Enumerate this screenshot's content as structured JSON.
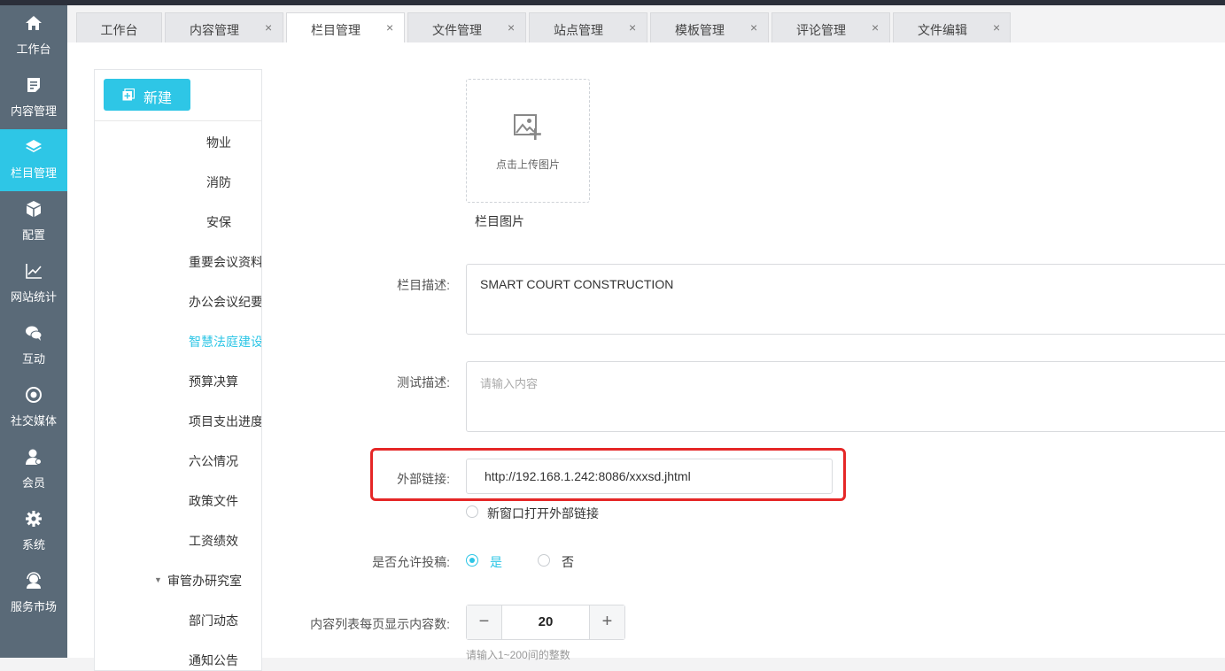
{
  "sidebar": {
    "items": [
      {
        "label": "工作台",
        "icon": "home-icon"
      },
      {
        "label": "内容管理",
        "icon": "document-icon"
      },
      {
        "label": "栏目管理",
        "icon": "layers-icon"
      },
      {
        "label": "配置",
        "icon": "cube-icon"
      },
      {
        "label": "网站统计",
        "icon": "line-chart-icon"
      },
      {
        "label": "互动",
        "icon": "chat-icon"
      },
      {
        "label": "社交媒体",
        "icon": "target-icon"
      },
      {
        "label": "会员",
        "icon": "member-icon"
      },
      {
        "label": "系统",
        "icon": "gear-icon"
      },
      {
        "label": "服务市场",
        "icon": "headset-icon"
      }
    ],
    "active_index": 2,
    "accent_color": "#2ec6e6"
  },
  "tabs": [
    {
      "label": "工作台"
    },
    {
      "label": "内容管理",
      "close": "×"
    },
    {
      "label": "栏目管理",
      "close": "×"
    },
    {
      "label": "文件管理",
      "close": "×"
    },
    {
      "label": "站点管理",
      "close": "×"
    },
    {
      "label": "模板管理",
      "close": "×"
    },
    {
      "label": "评论管理",
      "close": "×"
    },
    {
      "label": "文件编辑",
      "close": "×"
    }
  ],
  "tree": {
    "new_button": "新建",
    "items": [
      {
        "label": "物业"
      },
      {
        "label": "消防"
      },
      {
        "label": "安保"
      },
      {
        "label": "重要会议资料"
      },
      {
        "label": "办公会议纪要"
      },
      {
        "label": "智慧法庭建设",
        "selected": true
      },
      {
        "label": "预算决算"
      },
      {
        "label": "项目支出进度"
      },
      {
        "label": "六公情况"
      },
      {
        "label": "政策文件"
      },
      {
        "label": "工资绩效"
      },
      {
        "label": "审管办研究室",
        "expanded": true
      },
      {
        "label": "部门动态"
      },
      {
        "label": "通知公告"
      }
    ]
  },
  "form": {
    "upload_text": "点击上传图片",
    "image_caption": "栏目图片",
    "description": {
      "label": "栏目描述:",
      "value": "SMART COURT CONSTRUCTION"
    },
    "test_description": {
      "label": "测试描述:",
      "placeholder": "请输入内容"
    },
    "external_link": {
      "label": "外部链接:",
      "value": "http://192.168.1.242:8086/xxxsd.jhtml"
    },
    "open_new_window": {
      "label": "新窗口打开外部链接",
      "checked": false
    },
    "allow_submission": {
      "label": "是否允许投稿:",
      "options": [
        "是",
        "否"
      ],
      "selected": "是"
    },
    "page_size": {
      "label": "内容列表每页显示内容数:",
      "value": "20",
      "minus": "−",
      "plus": "+",
      "hint": "请输入1~200间的整数"
    }
  },
  "highlight_color": "#e52727"
}
